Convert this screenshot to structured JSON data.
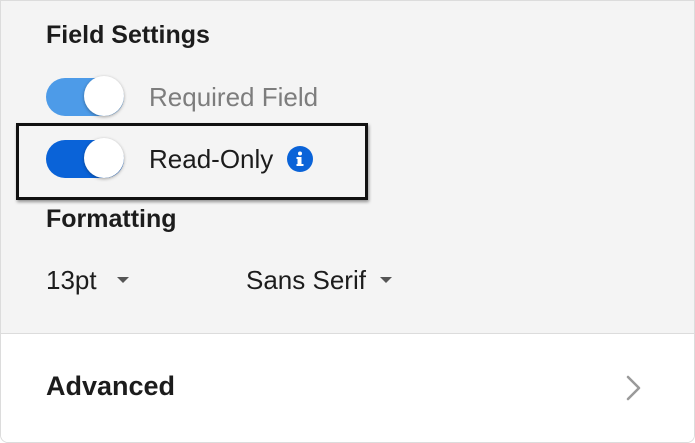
{
  "field_settings": {
    "title": "Field Settings",
    "required": {
      "label": "Required Field",
      "on": true
    },
    "read_only": {
      "label": "Read-Only",
      "on": true,
      "info_icon": "info-icon"
    }
  },
  "formatting": {
    "title": "Formatting",
    "font_size": {
      "value": "13pt"
    },
    "font_family": {
      "value": "Sans Serif"
    }
  },
  "advanced": {
    "label": "Advanced",
    "icon": "chevron-right-icon"
  },
  "colors": {
    "toggle_on": "#0a63d8",
    "toggle_dimmed": "#4d9be8",
    "panel_bg": "#f4f4f4",
    "highlight_border": "#111111"
  }
}
